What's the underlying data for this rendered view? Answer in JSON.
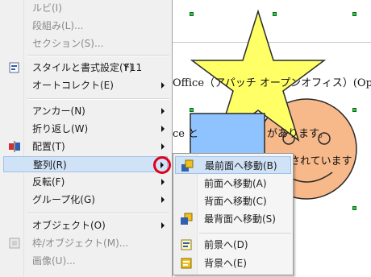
{
  "menu": {
    "items": [
      {
        "label": "ルビ(I)",
        "disabled": true
      },
      {
        "label": "段組み(L)...",
        "disabled": true
      },
      {
        "label": "セクション(S)...",
        "disabled": true
      },
      {
        "label": "スタイルと書式設定(Y)",
        "accel": "F11",
        "icon": "styles-icon"
      },
      {
        "label": "オートコレクト(E)",
        "submenu": true
      },
      {
        "label": "アンカー(N)",
        "submenu": true
      },
      {
        "label": "折り返し(W)",
        "submenu": true
      },
      {
        "label": "配置(T)",
        "submenu": true,
        "icon": "align-icon"
      },
      {
        "label": "整列(R)",
        "submenu": true,
        "highlighted": true
      },
      {
        "label": "反転(F)",
        "submenu": true
      },
      {
        "label": "グループ化(G)",
        "submenu": true
      },
      {
        "label": "オブジェクト(O)",
        "submenu": true
      },
      {
        "label": "枠/オブジェクト(M)...",
        "disabled": true,
        "icon": "frame-icon"
      },
      {
        "label": "画像(U)...",
        "disabled": true
      }
    ]
  },
  "submenu": {
    "items": [
      {
        "label": "最前面へ移動(B)",
        "icon": "bring-to-front-icon",
        "highlighted": true
      },
      {
        "label": "前面へ移動(A)"
      },
      {
        "label": "背面へ移動(C)"
      },
      {
        "label": "最背面へ移動(S)",
        "icon": "send-to-back-icon"
      },
      {
        "label": "前景へ(D)",
        "icon": "foreground-icon"
      },
      {
        "label": "背景へ(E)",
        "icon": "background-icon"
      }
    ]
  },
  "document": {
    "line1": "Office（アパッチ オープンオフィス）(Op",
    "line2": "ce と",
    "line2b": "があります。",
    "line3": "開されています"
  },
  "colors": {
    "star": "#ffff66",
    "smiley": "#f7b98a",
    "rectangle": "#8fc3ff",
    "highlight": "#cfe2f6",
    "callout": "#e0001a"
  }
}
